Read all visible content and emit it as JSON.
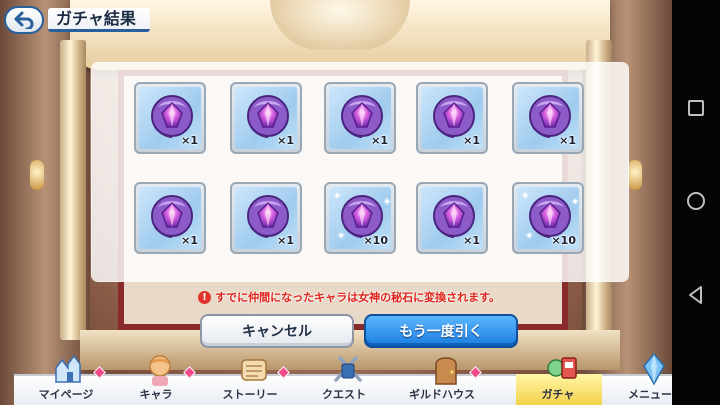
{
  "header": {
    "title": "ガチャ結果"
  },
  "results": {
    "items": [
      {
        "name": "gem-icon",
        "quantity": "×1",
        "sparkle": false
      },
      {
        "name": "gem-icon",
        "quantity": "×1",
        "sparkle": false
      },
      {
        "name": "gem-icon",
        "quantity": "×1",
        "sparkle": false
      },
      {
        "name": "gem-icon",
        "quantity": "×1",
        "sparkle": false
      },
      {
        "name": "gem-icon",
        "quantity": "×1",
        "sparkle": false
      },
      {
        "name": "gem-icon",
        "quantity": "×1",
        "sparkle": false
      },
      {
        "name": "gem-icon",
        "quantity": "×1",
        "sparkle": false
      },
      {
        "name": "gem-icon",
        "quantity": "×10",
        "sparkle": true
      },
      {
        "name": "gem-icon",
        "quantity": "×1",
        "sparkle": false
      },
      {
        "name": "gem-icon",
        "quantity": "×10",
        "sparkle": true
      }
    ]
  },
  "notice": {
    "text": "すでに仲間になったキャラは女神の秘石に変換されます。",
    "icon": "warning-icon",
    "color": "#e0241c"
  },
  "buttons": {
    "cancel_label": "キャンセル",
    "again_label": "もう一度引く"
  },
  "menu": {
    "items": [
      {
        "label": "マイページ",
        "icon": "castle-icon",
        "badge": true,
        "active": false
      },
      {
        "label": "キャラ",
        "icon": "character-icon",
        "badge": true,
        "active": false
      },
      {
        "label": "ストーリー",
        "icon": "scroll-icon",
        "badge": true,
        "active": false
      },
      {
        "label": "クエスト",
        "icon": "swords-icon",
        "badge": false,
        "active": false
      },
      {
        "label": "ギルドハウス",
        "icon": "door-icon",
        "badge": true,
        "active": false
      },
      {
        "label": "ガチャ",
        "icon": "gacha-icon",
        "badge": false,
        "active": true
      },
      {
        "label": "メニュー",
        "icon": "crystal-icon",
        "badge": false,
        "active": false
      }
    ]
  },
  "colors": {
    "accent_blue": "#1a7de0",
    "active_tab": "#f3d24a",
    "badge_pink": "#f04a87"
  }
}
